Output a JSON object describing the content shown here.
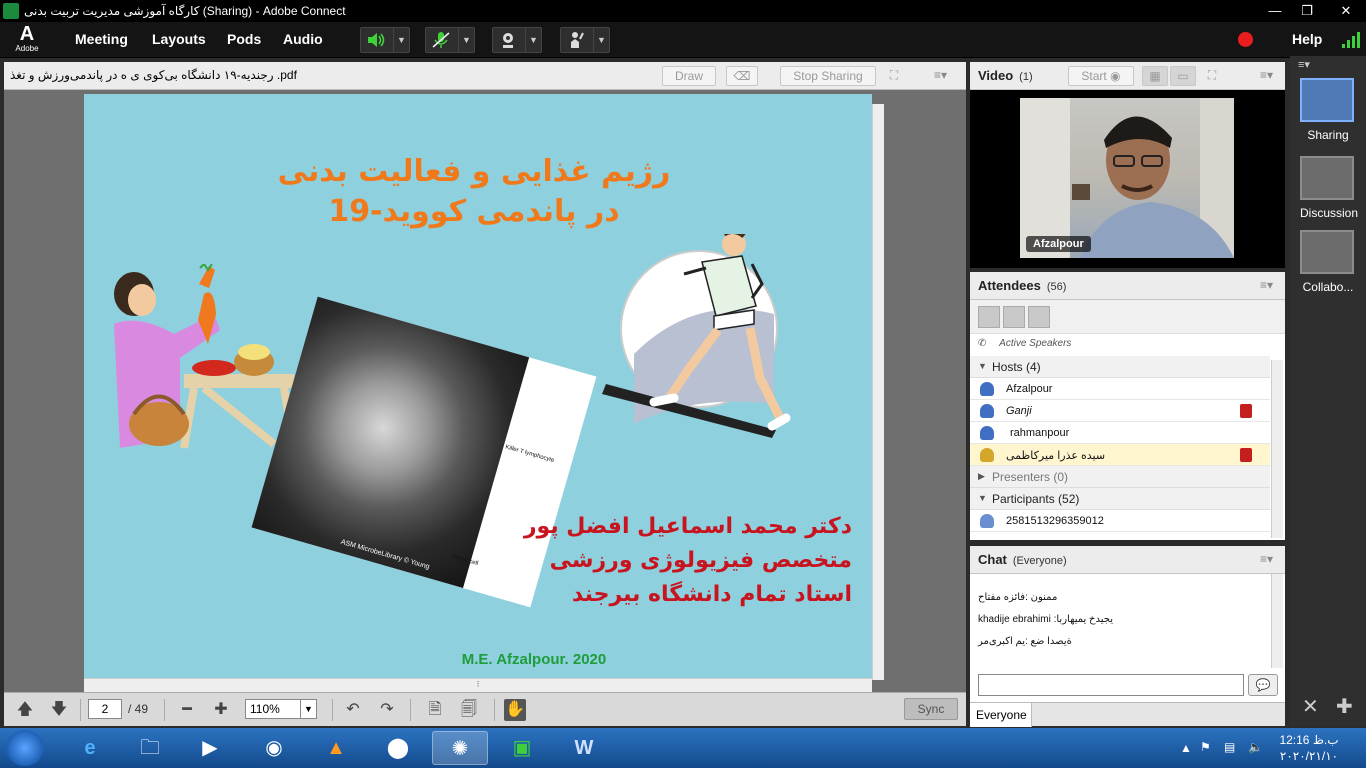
{
  "window": {
    "title": "کارگاه آموزشی مدیریت تربیت بدنی (Sharing) - Adobe Connect",
    "minimize": "—",
    "maximize": "❐",
    "close": "✕"
  },
  "menubar": {
    "logo_letter": "A",
    "logo_text": "Adobe",
    "items": [
      "Meeting",
      "Layouts",
      "Pods",
      "Audio"
    ],
    "help": "Help"
  },
  "share": {
    "file_name": "رجندیه-۱۹ دانشگاه بی‌کوی ی ه در پاندمی‌ورزش و تغذ .pdf",
    "draw_label": "Draw",
    "stop_sharing_label": "Stop Sharing",
    "page_current": "2",
    "page_total": "/ 49",
    "zoom": "110%",
    "sync_label": "Sync"
  },
  "slide": {
    "title_line1": "رژیم غذایی و فعالیت بدنی",
    "title_line2": "در پاندمی کووید-19",
    "author_line1": "دکتر محمد اسماعیل افضل پور",
    "author_line2": "متخصص فیزیولوژی ورزشی",
    "author_line3": "استاد تمام دانشگاه بیرجند",
    "footer": "M.E. Afzalpour. 2020",
    "micro_label1": "Killer T lymphocyte",
    "micro_label2": "Tumor cell",
    "micro_credit": "ASM MicrobeLibrary © Young"
  },
  "video": {
    "title": "Video",
    "count": "(1)",
    "start_label": "Start",
    "speaker_name": "Afzalpour"
  },
  "attendees": {
    "title": "Attendees",
    "count": "(56)",
    "active_speakers": "Active Speakers",
    "hosts_header": "Hosts (4)",
    "hosts": [
      {
        "name": "Afzalpour",
        "muted": false
      },
      {
        "name": "Ganji",
        "muted": true
      },
      {
        "name": "rahmanpour",
        "muted": false
      },
      {
        "name": "سیده عذرا میرکاظمی",
        "muted": true
      }
    ],
    "presenters_header": "Presenters (0)",
    "participants_header": "Participants (52)",
    "participants": [
      "2581513296359012"
    ]
  },
  "chat": {
    "title": "Chat",
    "audience": "(Everyone)",
    "messages": [
      "ممنون :فائزه مفتاح",
      "khadije ebrahimi :یجیدخ یمیهاربا",
      "ةیصدا ضع :یم اکبری‌مر"
    ],
    "send_icon": "💬",
    "footer_tab": "Everyone"
  },
  "layouts": {
    "items": [
      "Sharing",
      "Discussion",
      "Collabo..."
    ]
  },
  "taskbar": {
    "time": "12:16 ب.ظ",
    "date": "۲۰۲۰/۲۱/۱۰"
  }
}
